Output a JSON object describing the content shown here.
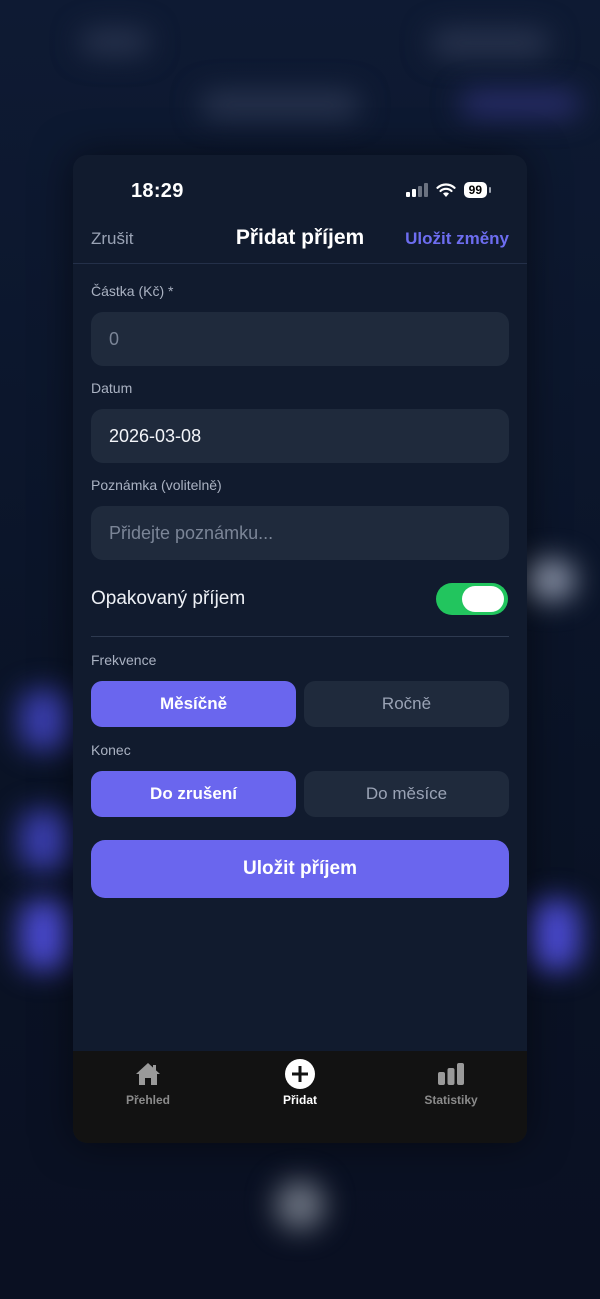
{
  "status_bar": {
    "time": "18:29",
    "battery": "99"
  },
  "nav": {
    "cancel": "Zrušit",
    "title": "Přidat příjem",
    "save": "Uložit změny"
  },
  "form": {
    "amount": {
      "label": "Částka (Kč) *",
      "placeholder": "0"
    },
    "date": {
      "label": "Datum",
      "value": "2026-03-08"
    },
    "note": {
      "label": "Poznámka (volitelně)",
      "placeholder": "Přidejte poznámku..."
    },
    "recurring": {
      "label": "Opakovaný příjem",
      "enabled": true
    },
    "frequency": {
      "label": "Frekvence",
      "options": [
        "Měsíčně",
        "Ročně"
      ],
      "selected": "Měsíčně"
    },
    "end": {
      "label": "Konec",
      "options": [
        "Do zrušení",
        "Do měsíce"
      ],
      "selected": "Do zrušení"
    },
    "submit": "Uložit příjem"
  },
  "tabbar": {
    "items": [
      {
        "label": "Přehled",
        "icon": "home-icon"
      },
      {
        "label": "Přidat",
        "icon": "plus-circle-icon"
      },
      {
        "label": "Statistiky",
        "icon": "bar-chart-icon"
      }
    ],
    "active": "Přidat"
  },
  "colors": {
    "accent": "#6a66ee",
    "toggle_on": "#22c55e",
    "sheet_bg": "#111b2e",
    "field_bg": "#1f2a3c"
  }
}
